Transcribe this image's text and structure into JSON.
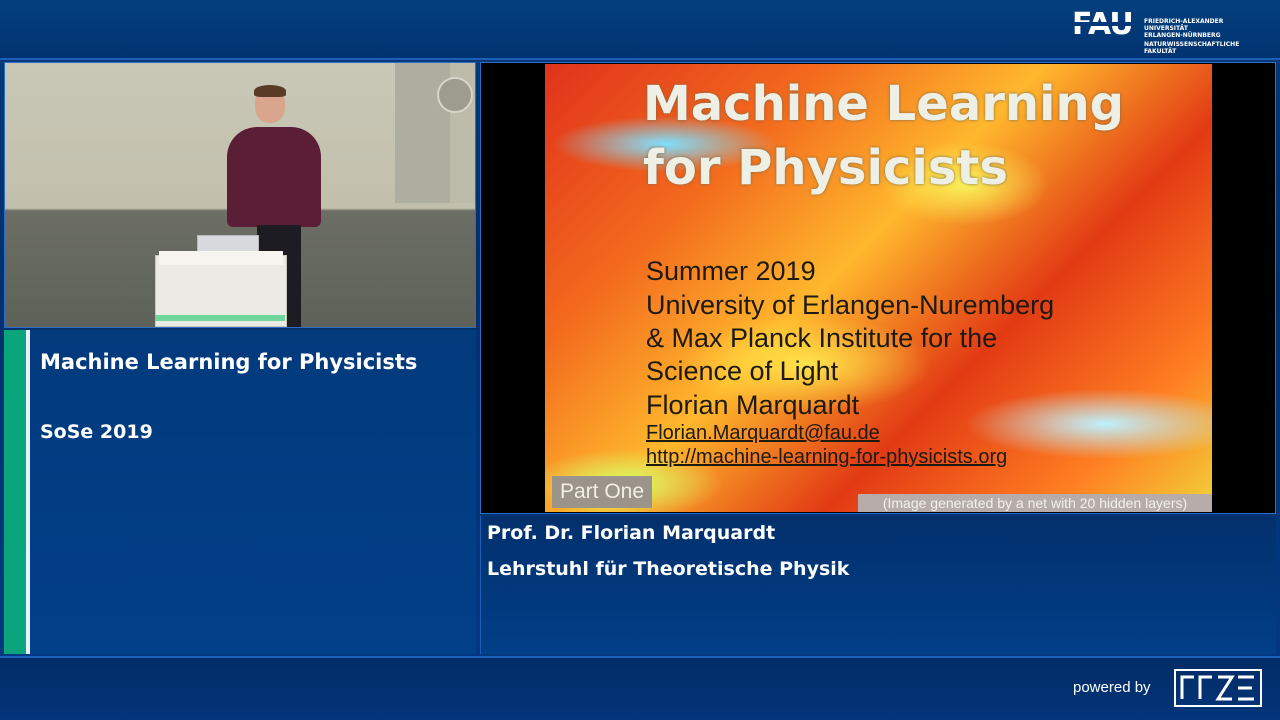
{
  "header": {
    "logo_text": "FAU",
    "logo_subtitle_lines": [
      "FRIEDRICH-ALEXANDER",
      "UNIVERSITÄT",
      "ERLANGEN-NÜRNBERG",
      "NATURWISSENSCHAFTLICHE",
      "FAKULTÄT"
    ]
  },
  "course": {
    "title": "Machine Learning for Physicists",
    "term": "SoSe 2019"
  },
  "slide": {
    "title": "Machine Learning for Physicists",
    "lines": [
      "Summer 2019",
      "University of Erlangen-Nuremberg",
      "& Max Planck Institute for the",
      "Science of Light",
      "Florian Marquardt"
    ],
    "email": "Florian.Marquardt@fau.de",
    "url": "http://machine-learning-for-physicists.org",
    "part_label": "Part One",
    "image_credit": "(Image generated by a net with 20 hidden layers)"
  },
  "lecturer": {
    "name": "Prof. Dr. Florian Marquardt",
    "chair": "Lehrstuhl für Theoretische Physik"
  },
  "footer": {
    "powered_by": "powered by",
    "logo_name": "rrze-logo"
  },
  "colors": {
    "background": "#02306b",
    "accent_green": "#0aa57d",
    "frame_blue": "#2b6cc4"
  }
}
